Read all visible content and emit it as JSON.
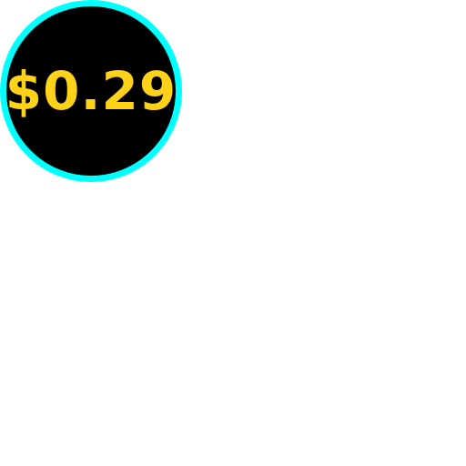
{
  "badge": {
    "price": "$0.29",
    "colors": {
      "background": "#000000",
      "ring": "#00ffff",
      "text": "#ffd21a"
    }
  }
}
